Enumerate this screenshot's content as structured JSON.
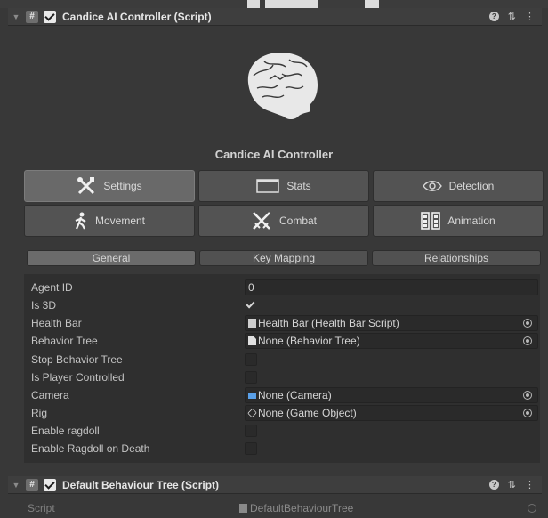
{
  "component1": {
    "title": "Candice AI Controller (Script)"
  },
  "controller": {
    "title": "Candice AI Controller"
  },
  "main_tabs": [
    {
      "label": "Settings",
      "icon": "wrench-screwdriver-icon"
    },
    {
      "label": "Stats",
      "icon": "window-icon"
    },
    {
      "label": "Detection",
      "icon": "eye-icon"
    },
    {
      "label": "Movement",
      "icon": "walking-person-icon"
    },
    {
      "label": "Combat",
      "icon": "crossed-swords-icon"
    },
    {
      "label": "Animation",
      "icon": "film-strip-icon"
    }
  ],
  "sub_tabs": [
    {
      "label": "General"
    },
    {
      "label": "Key Mapping"
    },
    {
      "label": "Relationships"
    }
  ],
  "properties": [
    {
      "label": "Agent ID",
      "value": "0"
    },
    {
      "label": "Is 3D",
      "checked": true
    },
    {
      "label": "Health Bar",
      "value": "Health Bar (Health Bar Script)"
    },
    {
      "label": "Behavior Tree",
      "value": "None (Behavior Tree)"
    },
    {
      "label": "Stop Behavior Tree",
      "checked": false
    },
    {
      "label": "Is Player Controlled",
      "checked": false
    },
    {
      "label": "Camera",
      "value": "None (Camera)"
    },
    {
      "label": "Rig",
      "value": "None (Game Object)"
    },
    {
      "label": "Enable ragdoll",
      "checked": false
    },
    {
      "label": "Enable Ragdoll on Death",
      "checked": false
    }
  ],
  "component2": {
    "title": "Default Behaviour Tree (Script)"
  },
  "script_row": {
    "label": "Script",
    "value": "DefaultBehaviourTree"
  },
  "colors": {
    "panel_bg": "#383838",
    "active_tab": "#696969",
    "field_bg": "#2a2a2a"
  }
}
